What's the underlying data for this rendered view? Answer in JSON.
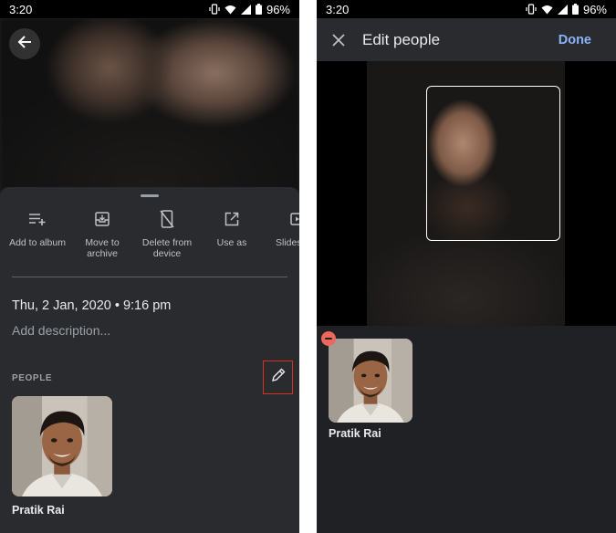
{
  "left": {
    "status": {
      "time": "3:20",
      "battery": "96%"
    },
    "actions": [
      {
        "label": "Add to album",
        "icon": "playlist-add-icon"
      },
      {
        "label": "Move to\narchive",
        "icon": "archive-icon"
      },
      {
        "label": "Delete from\ndevice",
        "icon": "phone-delete-icon"
      },
      {
        "label": "Use as",
        "icon": "open-external-icon"
      },
      {
        "label": "Slides",
        "icon": "slideshow-icon"
      }
    ],
    "datetime": "Thu, 2 Jan, 2020  •  9:16 pm",
    "description_placeholder": "Add description...",
    "people_header": "PEOPLE",
    "person_name": "Pratik Rai"
  },
  "right": {
    "status": {
      "time": "3:20",
      "battery": "96%"
    },
    "title": "Edit people",
    "done_label": "Done",
    "person_name": "Pratik Rai"
  },
  "colors": {
    "accent": "#8ab4f8",
    "highlight": "#d93025",
    "remove": "#ee675c",
    "background": "#202124"
  }
}
